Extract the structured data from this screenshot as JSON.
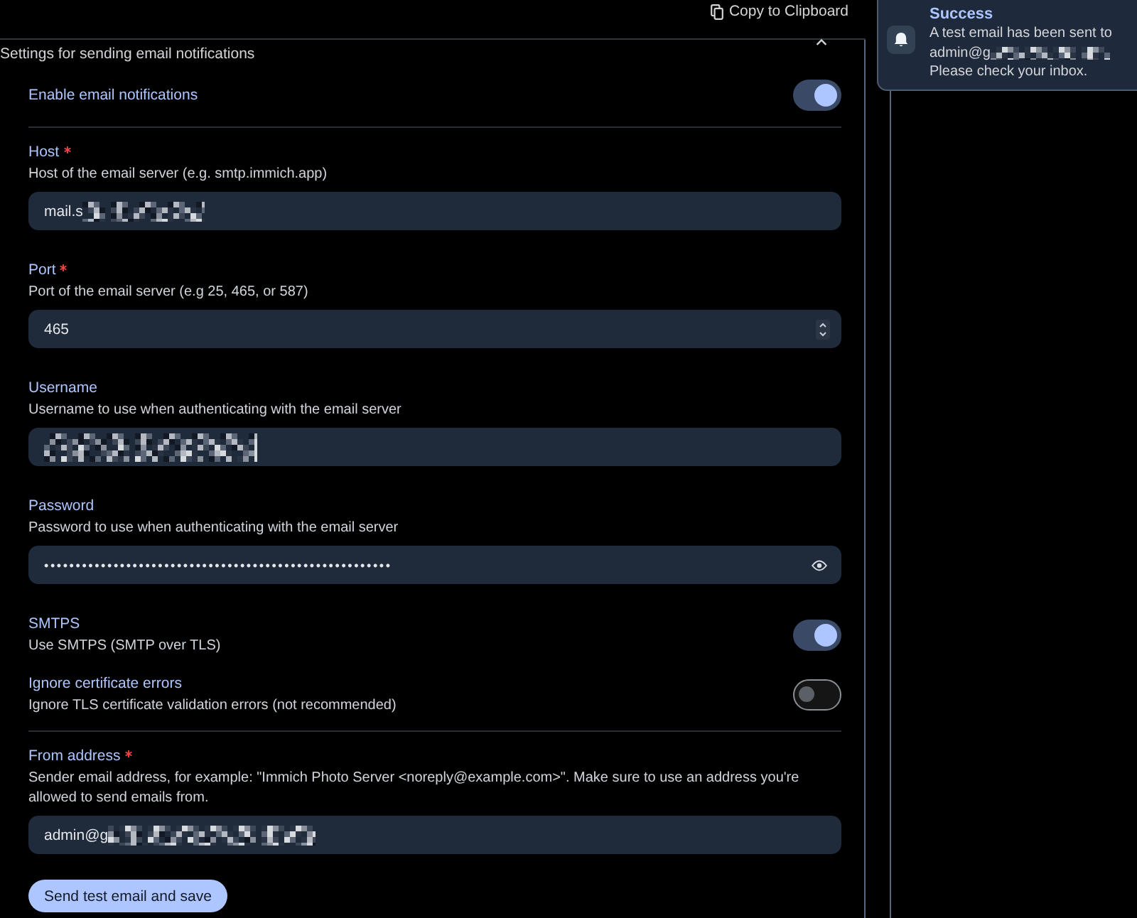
{
  "top_bar": {
    "copy_label": "Copy to Clipboard"
  },
  "panel": {
    "description": "Settings for sending email notifications"
  },
  "sections": [
    {
      "items": [
        {
          "kind": "toggle",
          "label": "Enable email notifications",
          "on": true
        }
      ]
    },
    {
      "items": [
        {
          "kind": "text",
          "label": "Host",
          "required": true,
          "description": "Host of the email server (e.g. smtp.immich.app)",
          "value": "mail.s",
          "redacted": true
        },
        {
          "kind": "number",
          "label": "Port",
          "required": true,
          "description": "Port of the email server (e.g 25, 465, or 587)",
          "value": "465",
          "redacted": false
        },
        {
          "kind": "text",
          "label": "Username",
          "required": false,
          "description": "Username to use when authenticating with the email server",
          "redacted": true
        },
        {
          "kind": "password",
          "label": "Password",
          "required": false,
          "description": "Password to use when authenticating with the email server",
          "value": "•••••••••••••••••••••••••••••••••••••••••••••••••••••••",
          "redacted": false
        },
        {
          "kind": "toggle",
          "label": "SMTPS",
          "description": "Use SMTPS (SMTP over TLS)",
          "on": true
        },
        {
          "kind": "toggle",
          "label": "Ignore certificate errors",
          "description": "Ignore TLS certificate validation errors (not recommended)",
          "on": false
        }
      ]
    },
    {
      "items": [
        {
          "kind": "text",
          "label": "From address",
          "required": true,
          "description": "Sender email address, for example: \"Immich Photo Server <noreply@example.com>\". Make sure to use an address you're allowed to send emails from.",
          "value": "admin@g",
          "redacted": true
        }
      ]
    }
  ],
  "send_button": "Send test email and save",
  "toast": {
    "title": "Success",
    "lines": [
      {
        "text": "A test email has been sent to",
        "redacted": false
      },
      {
        "text": "admin@g",
        "redacted": true
      },
      {
        "text": "Please check your inbox.",
        "redacted": false
      }
    ]
  }
}
